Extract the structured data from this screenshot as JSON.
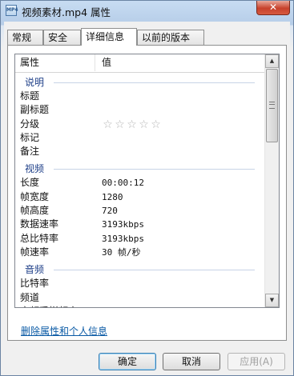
{
  "window": {
    "icon_text": "MP4",
    "title": "视频素材.mp4 属性",
    "close_label": "✕"
  },
  "tabs": [
    {
      "label": "常规"
    },
    {
      "label": "安全"
    },
    {
      "label": "详细信息"
    },
    {
      "label": "以前的版本"
    }
  ],
  "details": {
    "headers": {
      "property": "属性",
      "value": "值"
    },
    "groups": [
      {
        "label": "说明",
        "rows": [
          {
            "key": "标题",
            "value": ""
          },
          {
            "key": "副标题",
            "value": ""
          },
          {
            "key": "分级",
            "value": "",
            "rating_stars": 0
          },
          {
            "key": "标记",
            "value": ""
          },
          {
            "key": "备注",
            "value": ""
          }
        ]
      },
      {
        "label": "视频",
        "rows": [
          {
            "key": "长度",
            "value": "00:00:12"
          },
          {
            "key": "帧宽度",
            "value": "1280"
          },
          {
            "key": "帧高度",
            "value": "720"
          },
          {
            "key": "数据速率",
            "value": "3193kbps"
          },
          {
            "key": "总比特率",
            "value": "3193kbps"
          },
          {
            "key": "帧速率",
            "value": "30 帧/秒"
          }
        ]
      },
      {
        "label": "音频",
        "rows": [
          {
            "key": "比特率",
            "value": ""
          },
          {
            "key": "频道",
            "value": ""
          },
          {
            "key": "音频采样频率",
            "value": ""
          }
        ]
      }
    ]
  },
  "link": "删除属性和个人信息",
  "buttons": {
    "ok": "确定",
    "cancel": "取消",
    "apply": "应用(A)"
  }
}
